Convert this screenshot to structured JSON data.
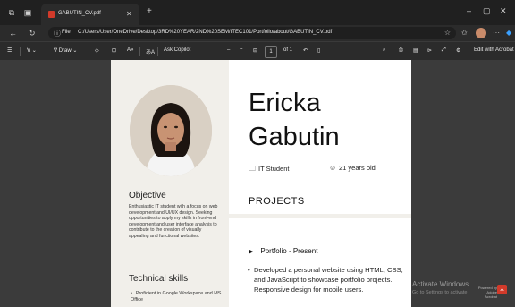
{
  "browser": {
    "tab_title": "GABUTIN_CV.pdf",
    "address_label": "File",
    "url": "C:/Users/User/OneDrive/Desktop/3RD%20YEAR/2ND%20SEM/ITEC101/Portfolio/about/GABUTIN_CV.pdf"
  },
  "pdf_toolbar": {
    "draw_label": "Draw",
    "copilot_label": "Ask Copilot",
    "page_current": "1",
    "page_total": "of 1",
    "edit_label": "Edit with Acrobat"
  },
  "cv": {
    "first_name": "Ericka",
    "last_name": "Gabutin",
    "role": "IT Student",
    "age": "21 years old",
    "objective_heading": "Objective",
    "objective_text": "Enthusiastic IT student with a focus on web development and UI/UX design. Seeking opportunities to apply my skills in front-end development and user interface analysis to contribute to the creation of visually appealing and functional websites.",
    "skills_heading": "Technical skills",
    "skills": [
      "Proficient in Google Workspace and MS Office"
    ],
    "projects_heading": "PROJECTS",
    "project_title": "Portfolio - Present",
    "project_desc": "Developed a personal website using HTML, CSS, and JavaScript to showcase portfolio projects. Responsive design for mobile users."
  },
  "overlay": {
    "activate_title": "Activate Windows",
    "activate_sub": "Go to Settings to activate",
    "powered_by": "Powered by",
    "adobe_acrobat": "Adobe Acrobat"
  },
  "icons": {
    "back": "arrow-left-icon",
    "refresh": "refresh-icon",
    "info": "info-icon",
    "role": "briefcase-icon",
    "age": "user-circle-icon",
    "acrobat": "acrobat-icon"
  },
  "colors": {
    "titlebar": "#202020",
    "toolbar": "#2b2b2b",
    "viewer_bg": "#3b3b3b",
    "sidebar_bg": "#f1efea",
    "acrobat_red": "#d23a2a"
  }
}
